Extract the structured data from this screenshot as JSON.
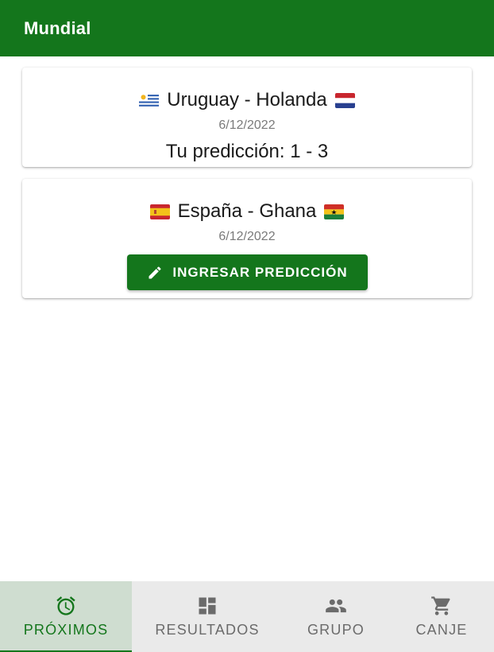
{
  "app": {
    "title": "Mundial"
  },
  "colors": {
    "primary": "#14761c",
    "nav_background": "#eaeaea",
    "nav_active_background": "#cfddd0",
    "muted_text": "#7a7a7a"
  },
  "matches": [
    {
      "home_flag": "uruguay-flag",
      "title": "Uruguay - Holanda",
      "away_flag": "netherlands-flag",
      "date": "6/12/2022",
      "prediction": "Tu predicción: 1 - 3"
    },
    {
      "home_flag": "spain-flag",
      "title": "España - Ghana",
      "away_flag": "ghana-flag",
      "date": "6/12/2022",
      "button_label": "INGRESAR PREDICCIÓN",
      "button_icon": "pencil-icon"
    }
  ],
  "bottom_nav": {
    "items": [
      {
        "label": "PRÓXIMOS",
        "icon": "alarm-clock-icon",
        "active": true
      },
      {
        "label": "RESULTADOS",
        "icon": "dashboard-icon",
        "active": false
      },
      {
        "label": "GRUPO",
        "icon": "group-icon",
        "active": false
      },
      {
        "label": "CANJE",
        "icon": "shopping-cart-icon",
        "active": false
      }
    ]
  }
}
